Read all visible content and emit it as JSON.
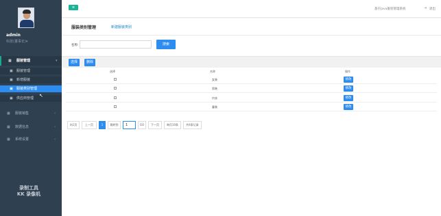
{
  "sidebar": {
    "user": {
      "name": "admin",
      "role": "科技(董事长)▾"
    },
    "groups": [
      {
        "label": "服装管理",
        "icon": "grid-icon",
        "arrow": "▾"
      },
      {
        "label": "服装销售",
        "icon": "grid-icon",
        "arrow": "‹"
      },
      {
        "label": "数据信息",
        "icon": "grid-icon",
        "arrow": "‹"
      },
      {
        "label": "系统设置",
        "icon": "grid-icon",
        "arrow": "‹"
      }
    ],
    "sub_items": [
      {
        "label": "服装管理"
      },
      {
        "label": "新增服装"
      },
      {
        "label": "服装类别管理"
      },
      {
        "label": "供应商管理"
      }
    ],
    "watermark": [
      "录制工具",
      "KK 录像机"
    ]
  },
  "topbar": {
    "menu_icon": "≡",
    "site_title": "基于Java服装管理系统",
    "exit_label": "退出"
  },
  "panel": {
    "title": "服装类别管理",
    "new_link": "新建服装类别",
    "search": {
      "label": "名称:",
      "value": "",
      "button": "搜索"
    },
    "toolbar": {
      "select_label": "选择",
      "delete_label": "删除"
    },
    "table": {
      "headers": [
        "选择",
        "名称",
        "操作"
      ],
      "rows": [
        {
          "name": "女装",
          "action": "修改"
        },
        {
          "name": "男装",
          "action": "修改"
        },
        {
          "name": "内衣",
          "action": "修改"
        },
        {
          "name": "童装",
          "action": "修改"
        }
      ]
    },
    "pager": {
      "first": "向1页",
      "prev": "上一页",
      "current": "1",
      "goto_label": "跳转到",
      "goto_value": "1",
      "go": "GO",
      "next": "下一页",
      "per_page": "每页10条",
      "total": "共4条记录"
    }
  },
  "colors": {
    "sidebar": "#2f4050",
    "accent": "#2d8cf0",
    "green": "#1ab394"
  }
}
